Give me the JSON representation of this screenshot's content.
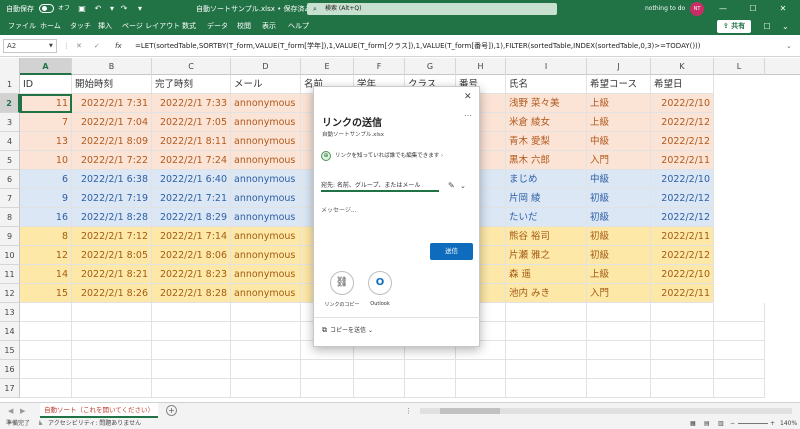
{
  "titlebar": {
    "autosave_label": "自動保存",
    "autosave_state": "オフ",
    "doc_title": "自動ソートサンプル.xlsx • 保存済み ∨",
    "search_placeholder": "検索 (Alt+Q)",
    "user_name": "nothing to do",
    "user_initials": "NT"
  },
  "menu": {
    "items": [
      "ファイル",
      "ホーム",
      "タッチ",
      "挿入",
      "ページ レイアウト",
      "数式",
      "データ",
      "校閲",
      "表示",
      "ヘルプ"
    ],
    "share_label": "共有"
  },
  "formula_bar": {
    "name_box": "A2",
    "fx_label": "fx",
    "formula": "=LET(sortedTable,SORTBY(T_form,VALUE(T_form[学年]),1,VALUE(T_form[クラス]),1,VALUE(T_form[番号]),1),FILTER(sortedTable,INDEX(sortedTable,0,3)>=TODAY()))"
  },
  "grid": {
    "columns": [
      "A",
      "B",
      "C",
      "D",
      "E",
      "F",
      "G",
      "H",
      "I",
      "J",
      "K",
      "L"
    ],
    "selected_column": "A",
    "row_numbers": [
      "1",
      "2",
      "3",
      "4",
      "5",
      "6",
      "7",
      "8",
      "9",
      "10",
      "11",
      "12",
      "13",
      "14",
      "15",
      "16",
      "17"
    ],
    "selected_row": "2",
    "header_row": {
      "A": "ID",
      "B": "開始時刻",
      "C": "完了時刻",
      "D": "メール",
      "E": "名前",
      "F": "学年",
      "G": "クラス",
      "H": "番号",
      "I": "氏名",
      "J": "希望コース",
      "K": "希望日"
    },
    "rows": [
      {
        "style": "pink",
        "A": "11",
        "B": "2022/2/1 7:31",
        "C": "2022/2/1 7:33",
        "D": "annonymous",
        "I": "浅野 菜々美",
        "J": "上級",
        "K": "2022/2/10"
      },
      {
        "style": "pink",
        "A": "7",
        "B": "2022/2/1 7:04",
        "C": "2022/2/1 7:05",
        "D": "annonymous",
        "I": "米倉 綾女",
        "J": "上級",
        "K": "2022/2/12"
      },
      {
        "style": "pink",
        "A": "13",
        "B": "2022/2/1 8:09",
        "C": "2022/2/1 8:11",
        "D": "annonymous",
        "I": "青木 愛梨",
        "J": "中級",
        "K": "2022/2/12"
      },
      {
        "style": "pink",
        "A": "10",
        "B": "2022/2/1 7:22",
        "C": "2022/2/1 7:24",
        "D": "annonymous",
        "I": "黒木 六郎",
        "J": "入門",
        "K": "2022/2/11"
      },
      {
        "style": "blue",
        "A": "6",
        "B": "2022/2/1 6:38",
        "C": "2022/2/1 6:40",
        "D": "annonymous",
        "I": "まじめ",
        "J": "中級",
        "K": "2022/2/10"
      },
      {
        "style": "blue",
        "A": "9",
        "B": "2022/2/1 7:19",
        "C": "2022/2/1 7:21",
        "D": "annonymous",
        "I": "片岡 綾",
        "J": "初級",
        "K": "2022/2/12"
      },
      {
        "style": "blue",
        "A": "16",
        "B": "2022/2/1 8:28",
        "C": "2022/2/1 8:29",
        "D": "annonymous",
        "I": "たいだ",
        "J": "初級",
        "K": "2022/2/12"
      },
      {
        "style": "yellow",
        "A": "8",
        "B": "2022/2/1 7:12",
        "C": "2022/2/1 7:14",
        "D": "annonymous",
        "I": "熊谷 裕司",
        "J": "初級",
        "K": "2022/2/11"
      },
      {
        "style": "yellow",
        "A": "12",
        "B": "2022/2/1 8:05",
        "C": "2022/2/1 8:06",
        "D": "annonymous",
        "I": "片瀬 雅之",
        "J": "初級",
        "K": "2022/2/12"
      },
      {
        "style": "yellow",
        "A": "14",
        "B": "2022/2/1 8:21",
        "C": "2022/2/1 8:23",
        "D": "annonymous",
        "I": "森 遥",
        "J": "上級",
        "K": "2022/2/10"
      },
      {
        "style": "yellow",
        "A": "15",
        "B": "2022/2/1 8:26",
        "C": "2022/2/1 8:28",
        "D": "annonymous",
        "I": "池内 みき",
        "J": "入門",
        "K": "2022/2/11"
      }
    ]
  },
  "dialog": {
    "title": "リンクの送信",
    "filename": "自動ソートサンプル.xlsx",
    "permission": "リンクを知っていれば誰でも編集できます",
    "to_placeholder": "宛先: 名前、グループ、またはメール",
    "message_placeholder": "メッセージ...",
    "send_label": "送信",
    "copy_link_label": "リンクのコピー",
    "outlook_label": "Outlook",
    "send_copy_label": "コピーを送信"
  },
  "sheet_tab": {
    "name": "自動ソート（これを開いてください）"
  },
  "status": {
    "ready": "準備完了",
    "accessibility": "アクセシビリティ: 問題ありません",
    "zoom": "140%"
  },
  "colors": {
    "excel_green": "#217346",
    "pink_row": "#fbe3d6",
    "blue_row": "#dbe7f5",
    "yellow_row": "#fde8a8",
    "send_button": "#0f6cbd"
  }
}
